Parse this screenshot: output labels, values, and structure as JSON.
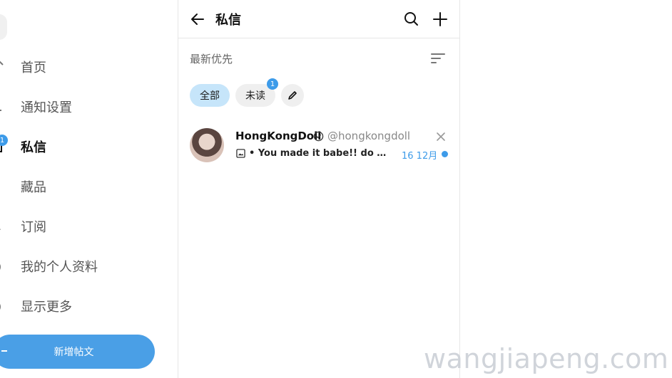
{
  "sidebar": {
    "items": [
      {
        "label": "首页",
        "icon": "home-icon"
      },
      {
        "label": "通知设置",
        "icon": "bell-icon"
      },
      {
        "label": "私信",
        "icon": "mail-icon",
        "badge": "1",
        "active": true
      },
      {
        "label": "藏品",
        "icon": "bookmark-icon"
      },
      {
        "label": "订阅",
        "icon": "subscriptions-icon"
      },
      {
        "label": "我的个人资料",
        "icon": "profile-icon"
      },
      {
        "label": "显示更多",
        "icon": "more-icon"
      }
    ],
    "new_post_label": "新增帖文"
  },
  "messages": {
    "title": "私信",
    "sort_label": "最新优先",
    "filters": {
      "all_label": "全部",
      "unread_label": "未读",
      "unread_badge": "1"
    },
    "conversations": [
      {
        "name": "HongKongDoll",
        "handle": "@hongkongdoll",
        "preview": "• You made it babe!! do you like it?",
        "date": "16 12月",
        "unread": true
      }
    ]
  },
  "watermark": "wangjiapeng.com",
  "colors": {
    "accent": "#3d9be9",
    "new_post_button": "#4a9fe6",
    "chip_active": "#c6e5fa",
    "chip_inactive": "#efefef"
  }
}
